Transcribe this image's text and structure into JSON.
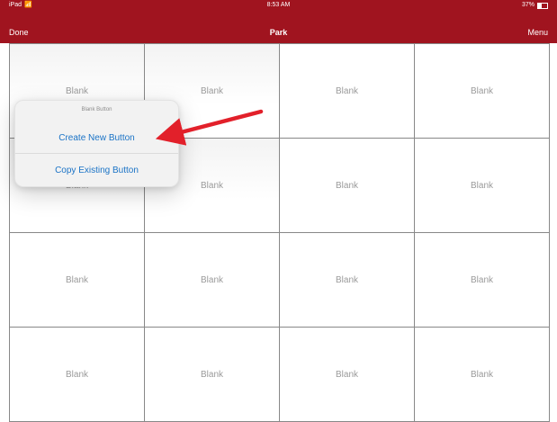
{
  "status": {
    "carrier": "iPad",
    "time": "8:53 AM",
    "battery": "37%"
  },
  "nav": {
    "done_label": "Done",
    "title": "Park",
    "menu_label": "Menu"
  },
  "grid": {
    "cells": [
      "Blank",
      "Blank",
      "Blank",
      "Blank",
      "Blank",
      "Blank",
      "Blank",
      "Blank",
      "Blank",
      "Blank",
      "Blank",
      "Blank",
      "Blank",
      "Blank",
      "Blank",
      "Blank"
    ]
  },
  "popover": {
    "title": "Blank Button",
    "create_label": "Create New Button",
    "copy_label": "Copy Existing Button"
  },
  "colors": {
    "header_red": "#a0141f",
    "action_blue": "#1a73c6",
    "arrow_red": "#e2202a"
  }
}
